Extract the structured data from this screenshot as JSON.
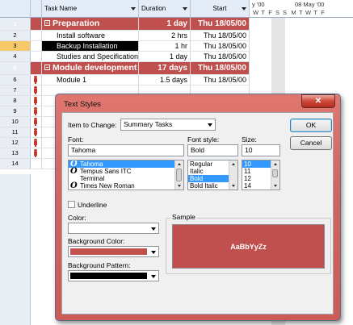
{
  "grid": {
    "columns": {
      "task_name": "Task Name",
      "duration": "Duration",
      "start": "Start"
    },
    "timescale": {
      "week1": "y '00",
      "week2": "08 May '00",
      "days1": [
        "W",
        "T",
        "F",
        "S",
        "S"
      ],
      "days2": [
        "M",
        "T",
        "W",
        "T",
        "F"
      ]
    },
    "rows": [
      {
        "num": "1",
        "name": "Preparation",
        "duration": "1 day",
        "start": "Thu 18/05/00",
        "type": "summary"
      },
      {
        "num": "2",
        "name": "Install software",
        "duration": "2 hrs",
        "start": "Thu 18/05/00",
        "type": "sub"
      },
      {
        "num": "3",
        "name": "Backup Installation",
        "duration": "1 hr",
        "start": "Thu 18/05/00",
        "type": "sub",
        "selected": true
      },
      {
        "num": "4",
        "name": "Studies and Specifications",
        "duration": "1 day",
        "start": "Thu 18/05/00",
        "type": "sub"
      },
      {
        "num": "5",
        "name": "Module development",
        "duration": "17 days",
        "start": "Thu 18/05/00",
        "type": "summary"
      },
      {
        "num": "6",
        "name": "Module 1",
        "duration": "1.5 days",
        "start": "Thu 18/05/00",
        "type": "sub",
        "resource_icon": true
      },
      {
        "num": "7",
        "resource_icon": true
      },
      {
        "num": "8",
        "resource_icon": true
      },
      {
        "num": "9",
        "resource_icon": true
      },
      {
        "num": "10",
        "resource_icon": true
      },
      {
        "num": "11",
        "resource_icon": true
      },
      {
        "num": "12",
        "resource_icon": true
      },
      {
        "num": "13",
        "resource_icon": true
      },
      {
        "num": "14"
      }
    ]
  },
  "dialog": {
    "title": "Text Styles",
    "close_glyph": "✕",
    "item_to_change_label": "Item to Change:",
    "item_to_change_value": "Summary Tasks",
    "ok_label": "OK",
    "cancel_label": "Cancel",
    "font_label": "Font:",
    "font_value": "Tahoma",
    "font_list": [
      {
        "name": "Tahoma",
        "icon": "opentype-icon",
        "glyph": "O",
        "selected": true
      },
      {
        "name": "Tempus Sans ITC",
        "icon": "opentype-icon",
        "glyph": "O"
      },
      {
        "name": "Terminal",
        "icon": "",
        "glyph": ""
      },
      {
        "name": "Times New Roman",
        "icon": "opentype-icon",
        "glyph": "O"
      }
    ],
    "font_style_label": "Font style:",
    "font_style_value": "Bold",
    "font_style_list": [
      {
        "name": "Regular"
      },
      {
        "name": "Italic"
      },
      {
        "name": "Bold",
        "selected": true
      },
      {
        "name": "Bold Italic"
      }
    ],
    "size_label": "Size:",
    "size_value": "10",
    "size_list": [
      {
        "name": "10",
        "selected": true
      },
      {
        "name": "11"
      },
      {
        "name": "12"
      },
      {
        "name": "14"
      }
    ],
    "underline_label": "Underline",
    "color_label": "Color:",
    "color_value": "#ffffff",
    "background_color_label": "Background Color:",
    "background_color_value": "#c0504d",
    "background_pattern_label": "Background Pattern:",
    "background_pattern_value": "#000000",
    "sample_label": "Sample",
    "sample_text": "AaBbYyZz"
  },
  "colors": {
    "summary_row": "#c0504d",
    "dialog_frame": "#d3635d",
    "selection": "#3399ff"
  }
}
